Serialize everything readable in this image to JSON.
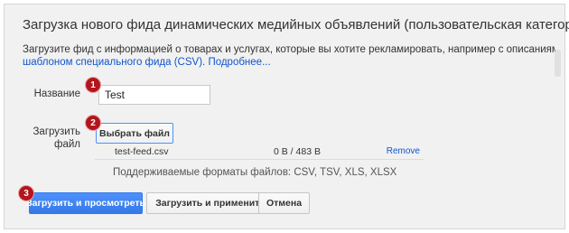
{
  "dialog": {
    "title": "Загрузка нового фида динамических медийных объявлений (пользовательская категория)",
    "description_line1": "Загрузите фид с информацией о товарах и услугах, которые вы хотите рекламировать, например с описаниями и ценами. Воспользуйтесь",
    "description_link": "шаблоном специального фида (CSV).",
    "description_more_link": "Подробнее..."
  },
  "form": {
    "name_label": "Название",
    "name_value": "Test",
    "upload_label": "Загрузить файл",
    "choose_file_button": "Выбрать файл",
    "file": {
      "name": "test-feed.csv",
      "size": "0 B / 483 B",
      "remove_link": "Remove"
    },
    "supported_formats": "Поддерживаемые форматы файлов: CSV, TSV, XLS, XLSX"
  },
  "actions": {
    "upload_preview": "Загрузить и просмотреть",
    "upload_apply": "Загрузить и применить",
    "cancel": "Отмена"
  },
  "badges": {
    "one": "1",
    "two": "2",
    "three": "3"
  },
  "colors": {
    "primary_button": "#4d90fe",
    "link": "#1155cc",
    "badge": "#b3151d"
  }
}
